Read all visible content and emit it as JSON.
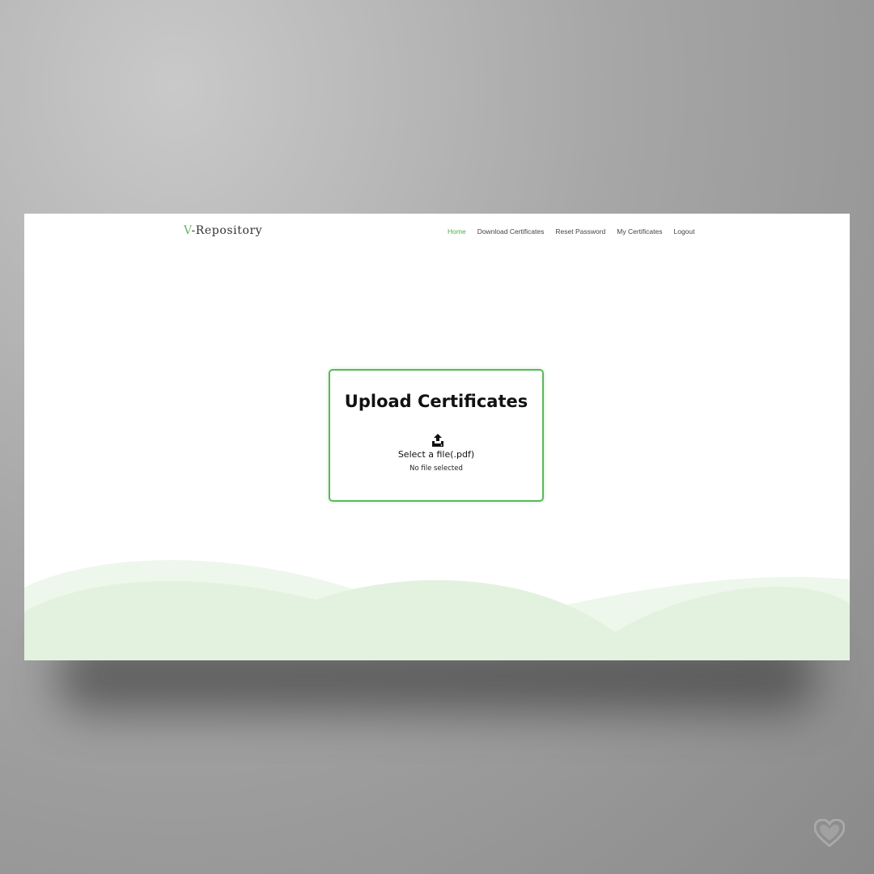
{
  "brand": {
    "first_letter": "V",
    "rest": "-Repository"
  },
  "nav": {
    "items": [
      {
        "label": "Home",
        "active": true
      },
      {
        "label": "Download Certificates",
        "active": false
      },
      {
        "label": "Reset Password",
        "active": false
      },
      {
        "label": "My Certificates",
        "active": false
      },
      {
        "label": "Logout",
        "active": false
      }
    ]
  },
  "upload": {
    "title": "Upload Certificates",
    "select_label": "Select a file(.pdf)",
    "status": "No file selected",
    "icon": "upload-icon"
  },
  "colors": {
    "accent": "#5cb85c",
    "wave_light": "#eef7ec",
    "wave_mid": "#e3f2df"
  }
}
